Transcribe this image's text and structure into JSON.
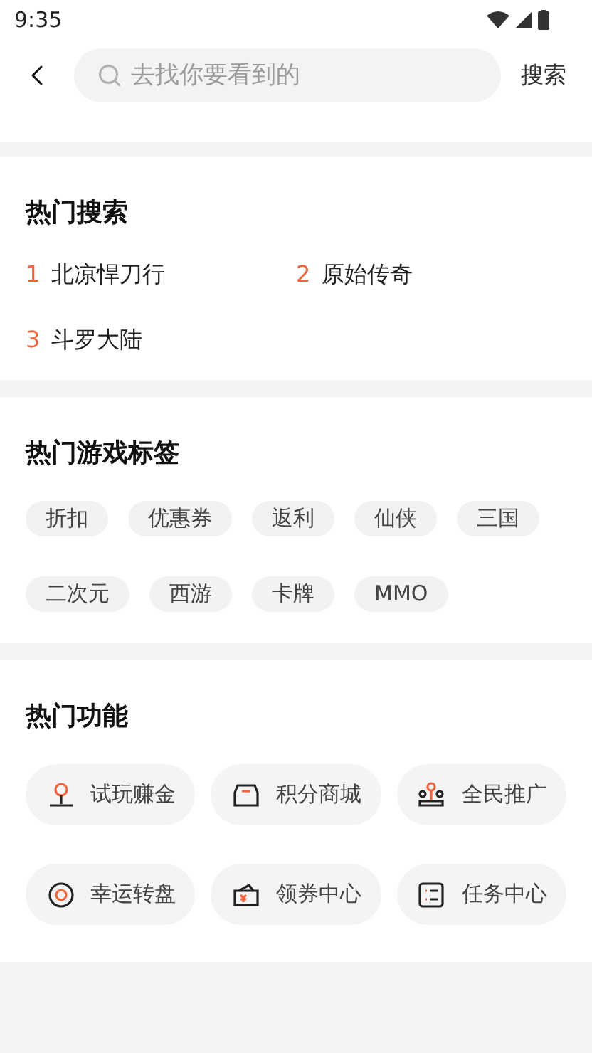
{
  "status_bar": {
    "time": "9:35"
  },
  "header": {
    "search": {
      "placeholder": "去找你要看到的"
    },
    "search_button": "搜索"
  },
  "hot_search": {
    "title": "热门搜索",
    "items": [
      {
        "rank": "1",
        "label": "北凉悍刀行"
      },
      {
        "rank": "2",
        "label": "原始传奇"
      },
      {
        "rank": "3",
        "label": "斗罗大陆"
      }
    ]
  },
  "hot_tags": {
    "title": "热门游戏标签",
    "tags": [
      "折扣",
      "优惠券",
      "返利",
      "仙侠",
      "三国",
      "二次元",
      "西游",
      "卡牌",
      "MMO"
    ]
  },
  "hot_functions": {
    "title": "热门功能",
    "items": [
      "试玩赚金",
      "积分商城",
      "全民推广",
      "幸运转盘",
      "领券中心",
      "任务中心"
    ]
  }
}
